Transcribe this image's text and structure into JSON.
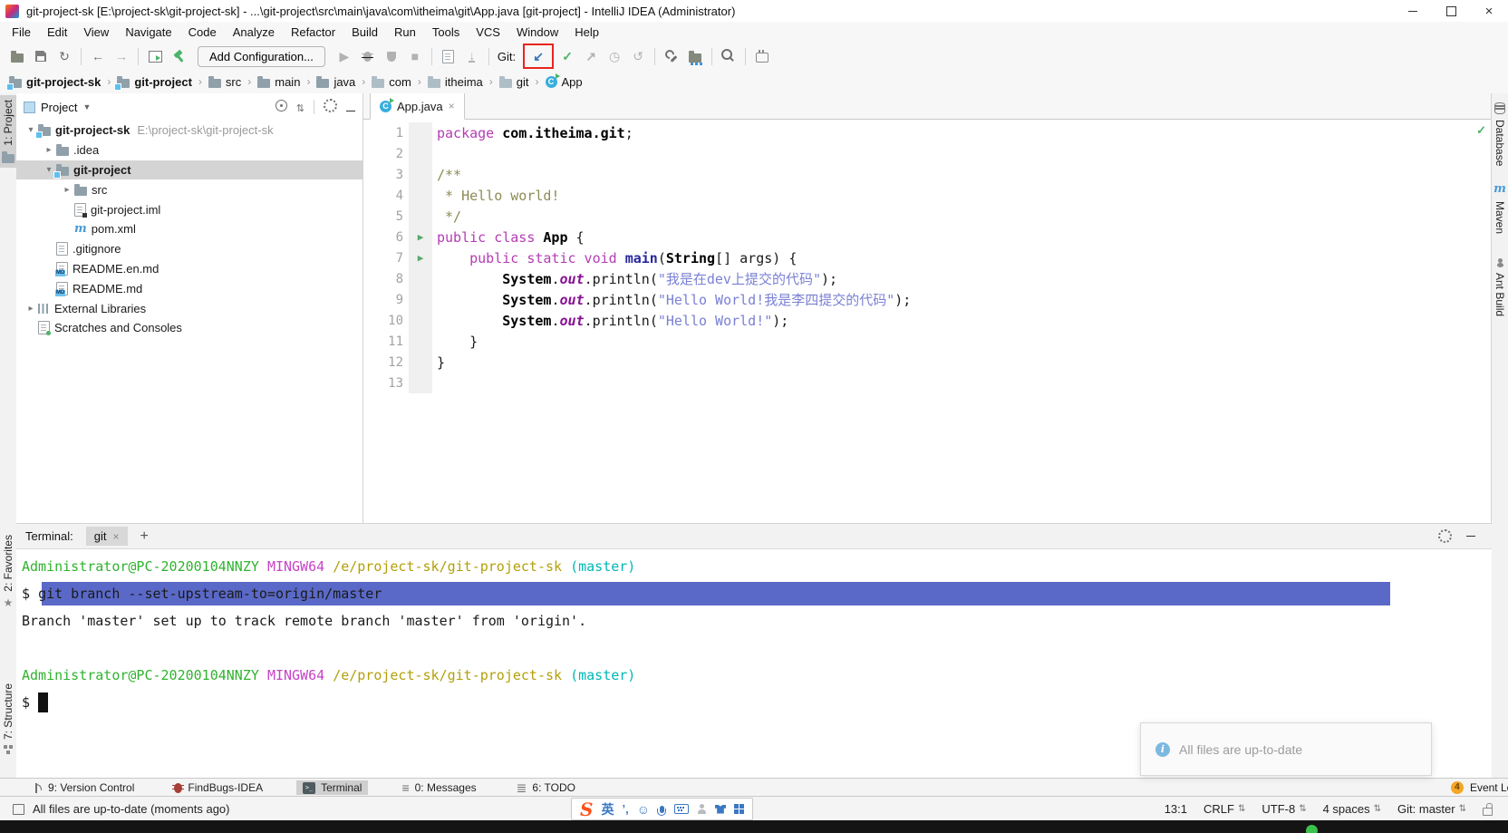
{
  "window": {
    "title": "git-project-sk [E:\\project-sk\\git-project-sk] - ...\\git-project\\src\\main\\java\\com\\itheima\\git\\App.java [git-project] - IntelliJ IDEA (Administrator)"
  },
  "menu": [
    "File",
    "Edit",
    "View",
    "Navigate",
    "Code",
    "Analyze",
    "Refactor",
    "Build",
    "Run",
    "Tools",
    "VCS",
    "Window",
    "Help"
  ],
  "toolbar": {
    "left_icons": [
      "open",
      "save",
      "sync",
      "sep",
      "back",
      "forward",
      "sep",
      "run-window",
      "hammer"
    ],
    "add_configuration": "Add Configuration...",
    "run_icons": [
      "run",
      "debug",
      "coverage",
      "stop",
      "sep",
      "profiler",
      "attach",
      "sep"
    ],
    "git_label": "Git:",
    "git_icons": [
      "update",
      "commit",
      "push",
      "history",
      "revert"
    ],
    "right_icons": [
      "sep",
      "wrench",
      "structure",
      "sep",
      "search",
      "sep",
      "plugin"
    ],
    "highlighted_icon": "update"
  },
  "breadcrumbs": [
    {
      "label": "git-project-sk",
      "icon": "module",
      "bold": true
    },
    {
      "label": "git-project",
      "icon": "module",
      "bold": true
    },
    {
      "label": "src",
      "icon": "folder"
    },
    {
      "label": "main",
      "icon": "folder"
    },
    {
      "label": "java",
      "icon": "folder"
    },
    {
      "label": "com",
      "icon": "package"
    },
    {
      "label": "itheima",
      "icon": "package"
    },
    {
      "label": "git",
      "icon": "package"
    },
    {
      "label": "App",
      "icon": "class"
    }
  ],
  "project": {
    "title": "Project",
    "header_icons": [
      "locate",
      "collapse",
      "sep",
      "settings",
      "hide"
    ],
    "tree": [
      {
        "indent": 0,
        "chevron": "open",
        "icon": "module",
        "label": "git-project-sk",
        "bold": true,
        "hint": "E:\\project-sk\\git-project-sk"
      },
      {
        "indent": 1,
        "chevron": "closed",
        "icon": "folder",
        "label": ".idea"
      },
      {
        "indent": 1,
        "chevron": "open",
        "icon": "module",
        "label": "git-project",
        "bold": true,
        "selected": true
      },
      {
        "indent": 2,
        "chevron": "closed",
        "icon": "folder",
        "label": "src"
      },
      {
        "indent": 2,
        "icon": "iml",
        "label": "git-project.iml"
      },
      {
        "indent": 2,
        "icon": "maven",
        "label": "pom.xml"
      },
      {
        "indent": 1,
        "icon": "file",
        "label": ".gitignore"
      },
      {
        "indent": 1,
        "icon": "md",
        "label": "README.en.md"
      },
      {
        "indent": 1,
        "icon": "md",
        "label": "README.md"
      },
      {
        "indent": 0,
        "chevron": "closed",
        "icon": "libs",
        "label": "External Libraries"
      },
      {
        "indent": 0,
        "icon": "scratch",
        "label": "Scratches and Consoles"
      }
    ]
  },
  "editor": {
    "tab": {
      "label": "App.java",
      "icon": "class",
      "close": "×"
    },
    "inspection_ok": "✓",
    "lines": [
      {
        "n": "1",
        "seg": [
          [
            "kw",
            "package"
          ],
          [
            "pl",
            " "
          ],
          [
            "b",
            "com.itheima.git"
          ],
          [
            "pl",
            ";"
          ]
        ]
      },
      {
        "n": "2",
        "seg": []
      },
      {
        "n": "3",
        "seg": [
          [
            "cm",
            "/**"
          ]
        ]
      },
      {
        "n": "4",
        "seg": [
          [
            "cm",
            " * Hello world!"
          ]
        ]
      },
      {
        "n": "5",
        "seg": [
          [
            "cm",
            " */"
          ]
        ]
      },
      {
        "n": "6",
        "run": true,
        "seg": [
          [
            "kw",
            "public class"
          ],
          [
            "pl",
            " "
          ],
          [
            "b",
            "App"
          ],
          [
            "pl",
            " {"
          ]
        ]
      },
      {
        "n": "7",
        "run": true,
        "seg": [
          [
            "pl",
            "    "
          ],
          [
            "kw",
            "public static void"
          ],
          [
            "pl",
            " "
          ],
          [
            "fn",
            "main"
          ],
          [
            "pl",
            "("
          ],
          [
            "b",
            "String"
          ],
          [
            "pl",
            "[] args) {"
          ]
        ]
      },
      {
        "n": "8",
        "seg": [
          [
            "pl",
            "        "
          ],
          [
            "b",
            "System"
          ],
          [
            "pl",
            "."
          ],
          [
            "fld",
            "out"
          ],
          [
            "pl",
            "."
          ],
          [
            "pl",
            "println"
          ],
          [
            "pl",
            "("
          ],
          [
            "str",
            "\"我是在dev上提交的代码\""
          ],
          [
            "pl",
            ");"
          ]
        ]
      },
      {
        "n": "9",
        "seg": [
          [
            "pl",
            "        "
          ],
          [
            "b",
            "System"
          ],
          [
            "pl",
            "."
          ],
          [
            "fld",
            "out"
          ],
          [
            "pl",
            "."
          ],
          [
            "pl",
            "println"
          ],
          [
            "pl",
            "("
          ],
          [
            "str",
            "\"Hello World!我是李四提交的代码\""
          ],
          [
            "pl",
            ");"
          ]
        ]
      },
      {
        "n": "10",
        "seg": [
          [
            "pl",
            "        "
          ],
          [
            "b",
            "System"
          ],
          [
            "pl",
            "."
          ],
          [
            "fld",
            "out"
          ],
          [
            "pl",
            "."
          ],
          [
            "pl",
            "println"
          ],
          [
            "pl",
            "("
          ],
          [
            "str",
            "\"Hello World!\""
          ],
          [
            "pl",
            ");"
          ]
        ]
      },
      {
        "n": "11",
        "seg": [
          [
            "pl",
            "    }"
          ]
        ]
      },
      {
        "n": "12",
        "seg": [
          [
            "pl",
            "}"
          ]
        ]
      },
      {
        "n": "13",
        "seg": []
      }
    ]
  },
  "left_stripe": {
    "top": [
      {
        "label": "1: Project",
        "icon": "project-folder",
        "selected": true
      }
    ],
    "bottom": [
      {
        "label": "2: Favorites",
        "icon": "star"
      },
      {
        "label": "7: Structure",
        "icon": "structure"
      }
    ]
  },
  "right_stripe": [
    {
      "label": "Database",
      "icon": "database"
    },
    {
      "label": "Maven",
      "icon": "maven"
    },
    {
      "label": "Ant Build",
      "icon": "ant"
    }
  ],
  "terminal": {
    "label": "Terminal:",
    "tab": "git",
    "tab_close": "×",
    "new_tab": "+",
    "header_icons": [
      "settings",
      "hide"
    ],
    "lines": [
      {
        "seg": [
          [
            "g",
            "Administrator@PC-20200104NNZY"
          ],
          [
            "pl",
            " "
          ],
          [
            "mg",
            "MINGW64"
          ],
          [
            "pl",
            " "
          ],
          [
            "ol",
            "/e/project-sk/git-project-sk"
          ],
          [
            "pl",
            " "
          ],
          [
            "cy",
            "(master)"
          ]
        ]
      },
      {
        "selected": true,
        "seg": [
          [
            "pl",
            "$ "
          ],
          [
            "pl",
            "git branch --set-upstream-to=origin/master"
          ]
        ]
      },
      {
        "seg": [
          [
            "pl",
            "Branch 'master' set up to track remote branch 'master' from 'origin'."
          ]
        ]
      },
      {
        "seg": []
      },
      {
        "seg": [
          [
            "g",
            "Administrator@PC-20200104NNZY"
          ],
          [
            "pl",
            " "
          ],
          [
            "mg",
            "MINGW64"
          ],
          [
            "pl",
            " "
          ],
          [
            "ol",
            "/e/project-sk/git-project-sk"
          ],
          [
            "pl",
            " "
          ],
          [
            "cy",
            "(master)"
          ]
        ]
      },
      {
        "seg": [
          [
            "pl",
            "$ "
          ],
          [
            "cur",
            ""
          ]
        ]
      }
    ]
  },
  "notification": {
    "text": "All files are up-to-date"
  },
  "tool_window_bar": {
    "tabs": [
      {
        "label": "9: Version Control",
        "icon": "branch"
      },
      {
        "label": "FindBugs-IDEA",
        "icon": "bug"
      },
      {
        "label": "Terminal",
        "icon": "terminal",
        "selected": true
      },
      {
        "label": "0: Messages",
        "icon": "messages"
      },
      {
        "label": "6: TODO",
        "icon": "todo"
      }
    ],
    "event_log": {
      "badge": "4",
      "label": "Event Log"
    }
  },
  "status_bar": {
    "left_text": "All files are up-to-date (moments ago)",
    "ime": {
      "logo": "S",
      "lang": "英",
      "punct": "’,",
      "smiley": "☺"
    },
    "right_items": [
      {
        "label": "13:1"
      },
      {
        "label": "CRLF",
        "dropdown": true
      },
      {
        "label": "UTF-8",
        "dropdown": true
      },
      {
        "label": "4 spaces",
        "dropdown": true
      },
      {
        "label": "Git: master",
        "dropdown": true
      }
    ]
  }
}
